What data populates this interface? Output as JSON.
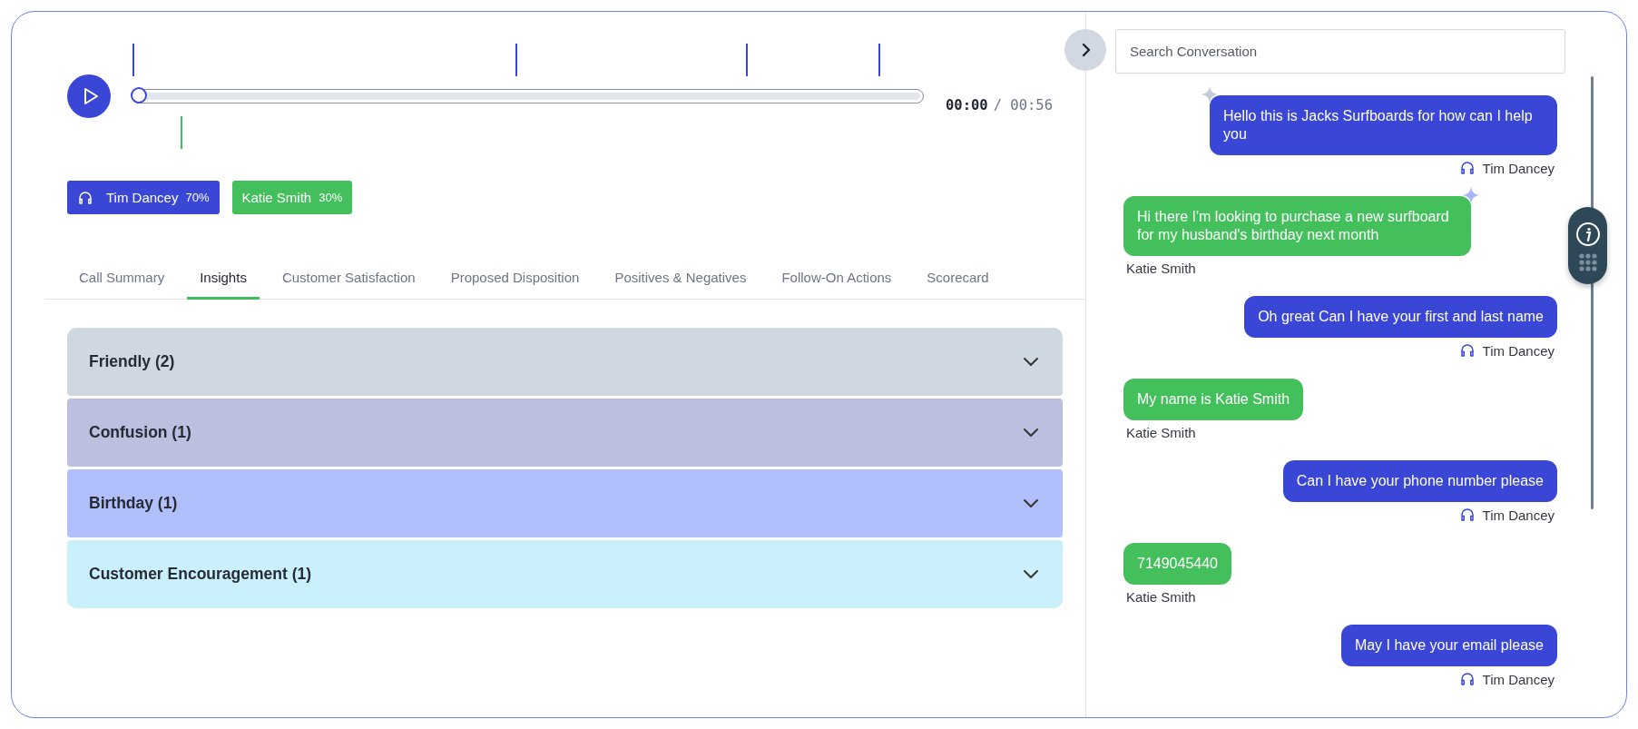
{
  "player": {
    "progress": {
      "level": 0
    },
    "current_time": "00:00",
    "duration": "/ 00:56",
    "markers": [
      {
        "kind": "agent",
        "level": 0.0,
        "color": "#3a46d6"
      },
      {
        "kind": "agent",
        "level": 0.485,
        "color": "#3a46d6"
      },
      {
        "kind": "agent",
        "level": 0.776,
        "color": "#3a46d6"
      },
      {
        "kind": "agent",
        "level": 0.944,
        "color": "#3a46d6"
      },
      {
        "kind": "customer",
        "level": 0.061,
        "color": "#43c05c"
      }
    ]
  },
  "speakers": [
    {
      "kind": "agent",
      "name": "Tim Dancey",
      "share": "70%",
      "color": "#3a46d6"
    },
    {
      "kind": "customer",
      "name": "Katie Smith",
      "share": "30%",
      "color": "#43c05c"
    }
  ],
  "tabs": [
    {
      "label": "Call Summary",
      "selected": false
    },
    {
      "label": "Insights",
      "selected": true
    },
    {
      "label": "Customer Satisfaction",
      "selected": false
    },
    {
      "label": "Proposed Disposition",
      "selected": false
    },
    {
      "label": "Positives & Negatives",
      "selected": false
    },
    {
      "label": "Follow-On Actions",
      "selected": false
    },
    {
      "label": "Scorecard",
      "selected": false
    }
  ],
  "insights": [
    {
      "title": "Friendly (2)",
      "color": "#cfd8e1",
      "expanded": false
    },
    {
      "title": "Confusion (1)",
      "color": "#bdbfe1",
      "expanded": false
    },
    {
      "title": "Birthday (1)",
      "color": "#b1c0fc",
      "expanded": false
    },
    {
      "title": "Customer Encouragement (1)",
      "color": "#c9f0fb",
      "expanded": false
    }
  ],
  "conversation": {
    "search": {
      "placeholder": "Search Conversation"
    },
    "messages": [
      {
        "kind": "agent",
        "text": "Hello this is Jacks Surfboards for how can I help you",
        "speaker": "Tim Dancey",
        "flagged": true
      },
      {
        "kind": "customer",
        "text": "Hi there I'm looking to purchase a new surfboard for my husband's birthday next month",
        "speaker": "Katie Smith",
        "flagged": true
      },
      {
        "kind": "agent",
        "text": "Oh great Can I have your first and last name",
        "speaker": "Tim Dancey",
        "flagged": false
      },
      {
        "kind": "customer",
        "text": "My name is Katie Smith",
        "speaker": "Katie Smith",
        "flagged": false
      },
      {
        "kind": "agent",
        "text": "Can I have your phone number please",
        "speaker": "Tim Dancey",
        "flagged": false
      },
      {
        "kind": "customer",
        "text": "7149045440",
        "speaker": "Katie Smith",
        "flagged": false
      },
      {
        "kind": "agent",
        "text": "May I have your email please",
        "speaker": "Tim Dancey",
        "flagged": false
      }
    ]
  }
}
